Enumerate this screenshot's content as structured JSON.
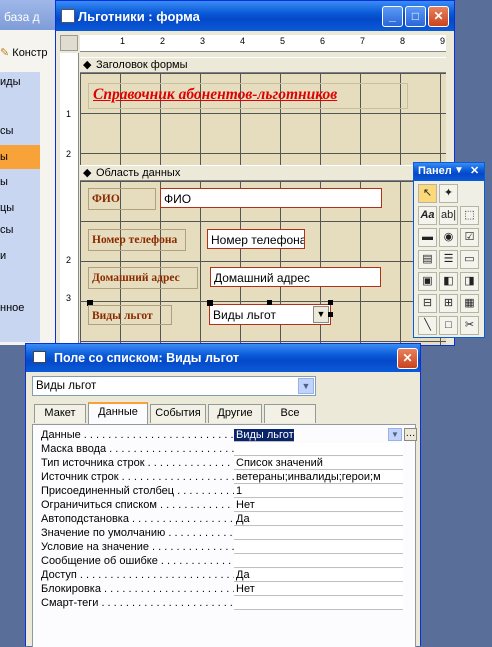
{
  "db_window": {
    "title": "база д",
    "toolbar_label": "Констр",
    "items": [
      "иды",
      "сы",
      "ы",
      "ы",
      "цы",
      "сы",
      "и",
      "нное"
    ]
  },
  "form_window": {
    "title": "Льготники : форма",
    "ruler_numbers": [
      "1",
      "2",
      "3",
      "4",
      "5",
      "6",
      "7",
      "8",
      "9"
    ],
    "header_section": "Заголовок формы",
    "detail_section": "Область данных",
    "form_title": "Справочник абонентов-льготников",
    "fields": [
      {
        "label": "ФИО",
        "value": "ФИО"
      },
      {
        "label": "Номер телефона",
        "value": "Номер телефона"
      },
      {
        "label": "Домашний адрес",
        "value": "Домашний адрес"
      },
      {
        "label": "Виды льгот",
        "value": "Виды льгот"
      }
    ]
  },
  "toolbox": {
    "title": "Панел"
  },
  "props": {
    "title": "Поле со списком: Виды льгот",
    "object_selector": "Виды льгот",
    "tabs": [
      "Макет",
      "Данные",
      "События",
      "Другие",
      "Все"
    ],
    "active_tab": "Данные",
    "rows": [
      {
        "name": "Данные",
        "value": "Виды льгот"
      },
      {
        "name": "Маска ввода",
        "value": ""
      },
      {
        "name": "Тип источника строк",
        "value": "Список значений"
      },
      {
        "name": "Источник строк",
        "value": "ветераны;инвалиды;герои;м"
      },
      {
        "name": "Присоединенный столбец",
        "value": "1"
      },
      {
        "name": "Ограничиться списком",
        "value": "Нет"
      },
      {
        "name": "Автоподстановка",
        "value": "Да"
      },
      {
        "name": "Значение по умолчанию",
        "value": ""
      },
      {
        "name": "Условие на значение",
        "value": ""
      },
      {
        "name": "Сообщение об ошибке",
        "value": ""
      },
      {
        "name": "Доступ",
        "value": "Да"
      },
      {
        "name": "Блокировка",
        "value": "Нет"
      },
      {
        "name": "Смарт-теги",
        "value": ""
      }
    ]
  }
}
